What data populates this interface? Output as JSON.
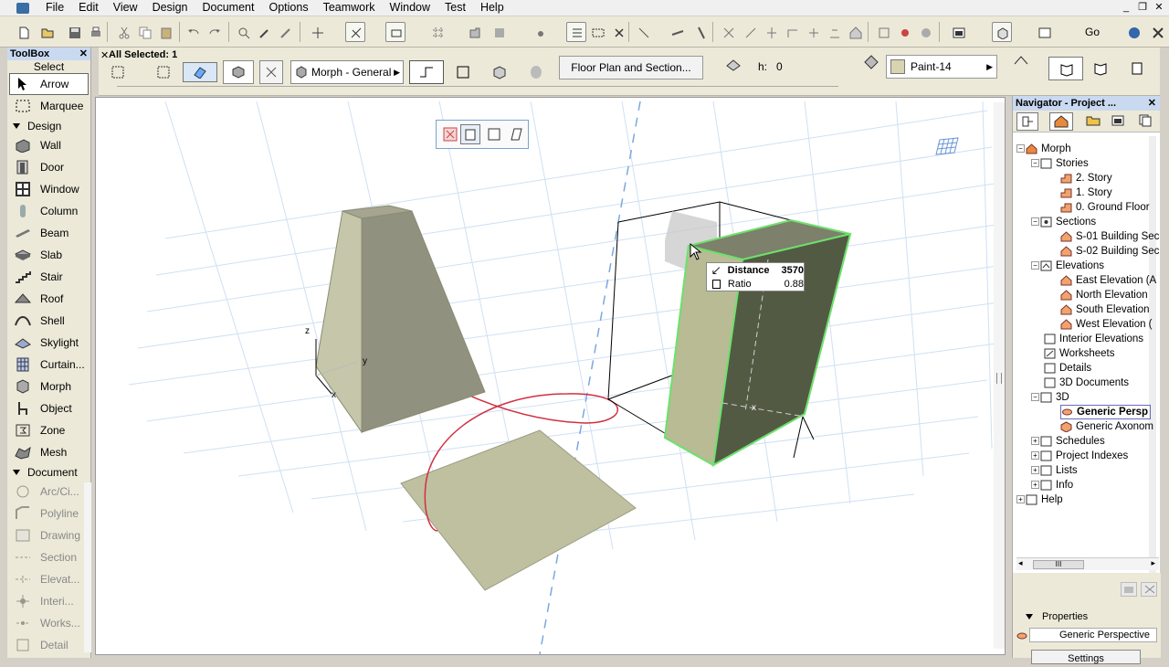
{
  "menu": [
    "File",
    "Edit",
    "View",
    "Design",
    "Document",
    "Options",
    "Teamwork",
    "Window",
    "Test",
    "Help"
  ],
  "infobox": {
    "selection": "All Selected: 1",
    "element_type": "Morph - General",
    "floor_plan_button": "Floor Plan and Section...",
    "h_label": "h:",
    "h_value": "0",
    "material": "Paint-14"
  },
  "toolbar_right": {
    "go_label": "Go"
  },
  "toolbox": {
    "title": "ToolBox",
    "select_label": "Select",
    "select_tools": [
      {
        "label": "Arrow"
      },
      {
        "label": "Marquee"
      }
    ],
    "design_group": "Design",
    "design_tools": [
      {
        "label": "Wall"
      },
      {
        "label": "Door"
      },
      {
        "label": "Window"
      },
      {
        "label": "Column"
      },
      {
        "label": "Beam"
      },
      {
        "label": "Slab"
      },
      {
        "label": "Stair"
      },
      {
        "label": "Roof"
      },
      {
        "label": "Shell"
      },
      {
        "label": "Skylight"
      },
      {
        "label": "Curtain..."
      },
      {
        "label": "Morph"
      },
      {
        "label": "Object"
      },
      {
        "label": "Zone"
      },
      {
        "label": "Mesh"
      }
    ],
    "document_group": "Document",
    "document_tools": [
      {
        "label": "Arc/Ci..."
      },
      {
        "label": "Polyline"
      },
      {
        "label": "Drawing"
      },
      {
        "label": "Section"
      },
      {
        "label": "Elevat..."
      },
      {
        "label": "Interi..."
      },
      {
        "label": "Works..."
      },
      {
        "label": "Detail"
      }
    ]
  },
  "tracker": {
    "distance_label": "Distance",
    "distance_value": "3570",
    "ratio_label": "Ratio",
    "ratio_value": "0.88"
  },
  "viewport_axes": {
    "z": "z",
    "y": "y",
    "x": "x"
  },
  "navigator": {
    "title": "Navigator - Project ...",
    "tree": {
      "root": "Morph",
      "stories": "Stories",
      "story_items": [
        "2. Story",
        "1. Story",
        "0. Ground Floor"
      ],
      "sections": "Sections",
      "section_items": [
        "S-01 Building Sec",
        "S-02 Building Sec"
      ],
      "elevations": "Elevations",
      "elevation_items": [
        "East Elevation (A",
        "North Elevation",
        "South Elevation",
        "West Elevation ("
      ],
      "interior_elevations": "Interior Elevations",
      "worksheets": "Worksheets",
      "details": "Details",
      "documents_3d": "3D Documents",
      "threed": "3D",
      "threed_items": [
        "Generic Persp",
        "Generic Axonom"
      ],
      "schedules": "Schedules",
      "project_indexes": "Project Indexes",
      "lists": "Lists",
      "info": "Info",
      "help": "Help"
    },
    "scroll_thumb_label": "III",
    "properties_label": "Properties",
    "properties_value": "Generic Perspective",
    "settings_button": "Settings"
  }
}
